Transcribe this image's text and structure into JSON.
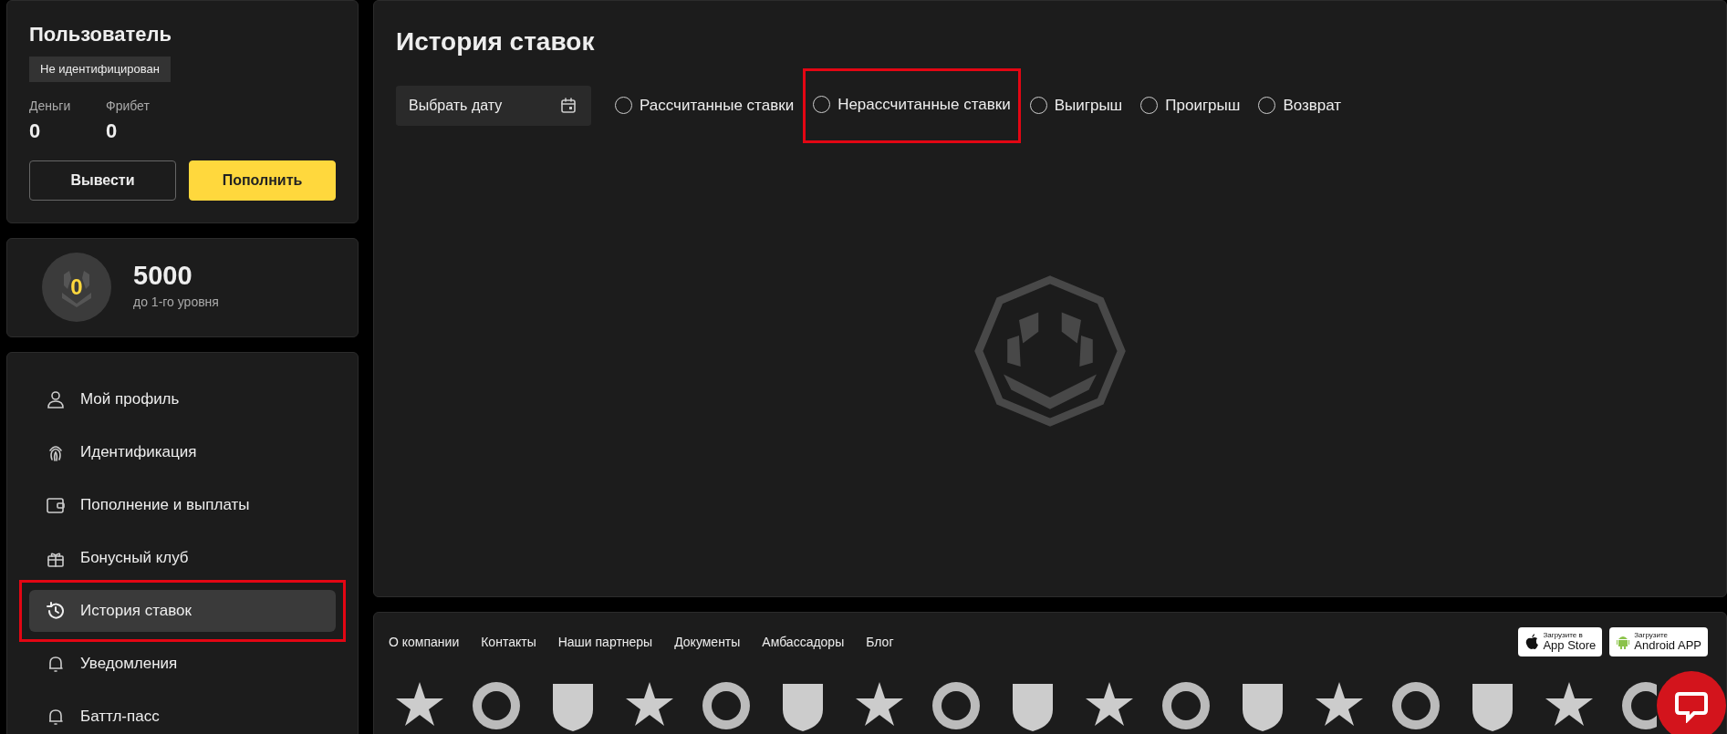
{
  "user_card": {
    "title": "Пользователь",
    "status_badge": "Не идентифицирован",
    "balances": [
      {
        "label": "Деньги",
        "value": "0"
      },
      {
        "label": "Фрибет",
        "value": "0"
      }
    ],
    "buttons": [
      {
        "label": "Вывести",
        "kind": "outline"
      },
      {
        "label": "Пополнить",
        "kind": "primary"
      }
    ]
  },
  "level_card": {
    "badge_number": "0",
    "points": "5000",
    "caption": "до 1-го уровня"
  },
  "menu": [
    {
      "label": "Мой профиль",
      "selected": false,
      "annotated": false
    },
    {
      "label": "Идентификация",
      "selected": false,
      "annotated": false
    },
    {
      "label": "Пополнение и выплаты",
      "selected": false,
      "annotated": false
    },
    {
      "label": "Бонусный клуб",
      "selected": false,
      "annotated": false
    },
    {
      "label": "История ставок",
      "selected": true,
      "annotated": true
    },
    {
      "label": "Уведомления",
      "selected": false,
      "annotated": false
    },
    {
      "label": "Баттл-пасс",
      "selected": false,
      "annotated": false
    }
  ],
  "bet_history": {
    "title": "История ставок",
    "date_field": {
      "placeholder": "Выбрать дату"
    },
    "filters": [
      {
        "label": "Рассчитанные ставки",
        "selected": false,
        "annotated": false
      },
      {
        "label": "Нерассчитанные ставки",
        "selected": false,
        "annotated": true
      },
      {
        "label": "Выигрыш",
        "selected": false,
        "annotated": false
      },
      {
        "label": "Проигрыш",
        "selected": false,
        "annotated": false
      },
      {
        "label": "Возврат",
        "selected": false,
        "annotated": false
      }
    ]
  },
  "footer": {
    "links": [
      "О компании",
      "Контакты",
      "Наши партнеры",
      "Документы",
      "Амбассадоры",
      "Блог"
    ],
    "app_badges": [
      {
        "kind": "apple",
        "small": "Загрузите в",
        "big": "App Store"
      },
      {
        "kind": "android",
        "small": "Загрузите",
        "big": "Android APP"
      }
    ]
  }
}
